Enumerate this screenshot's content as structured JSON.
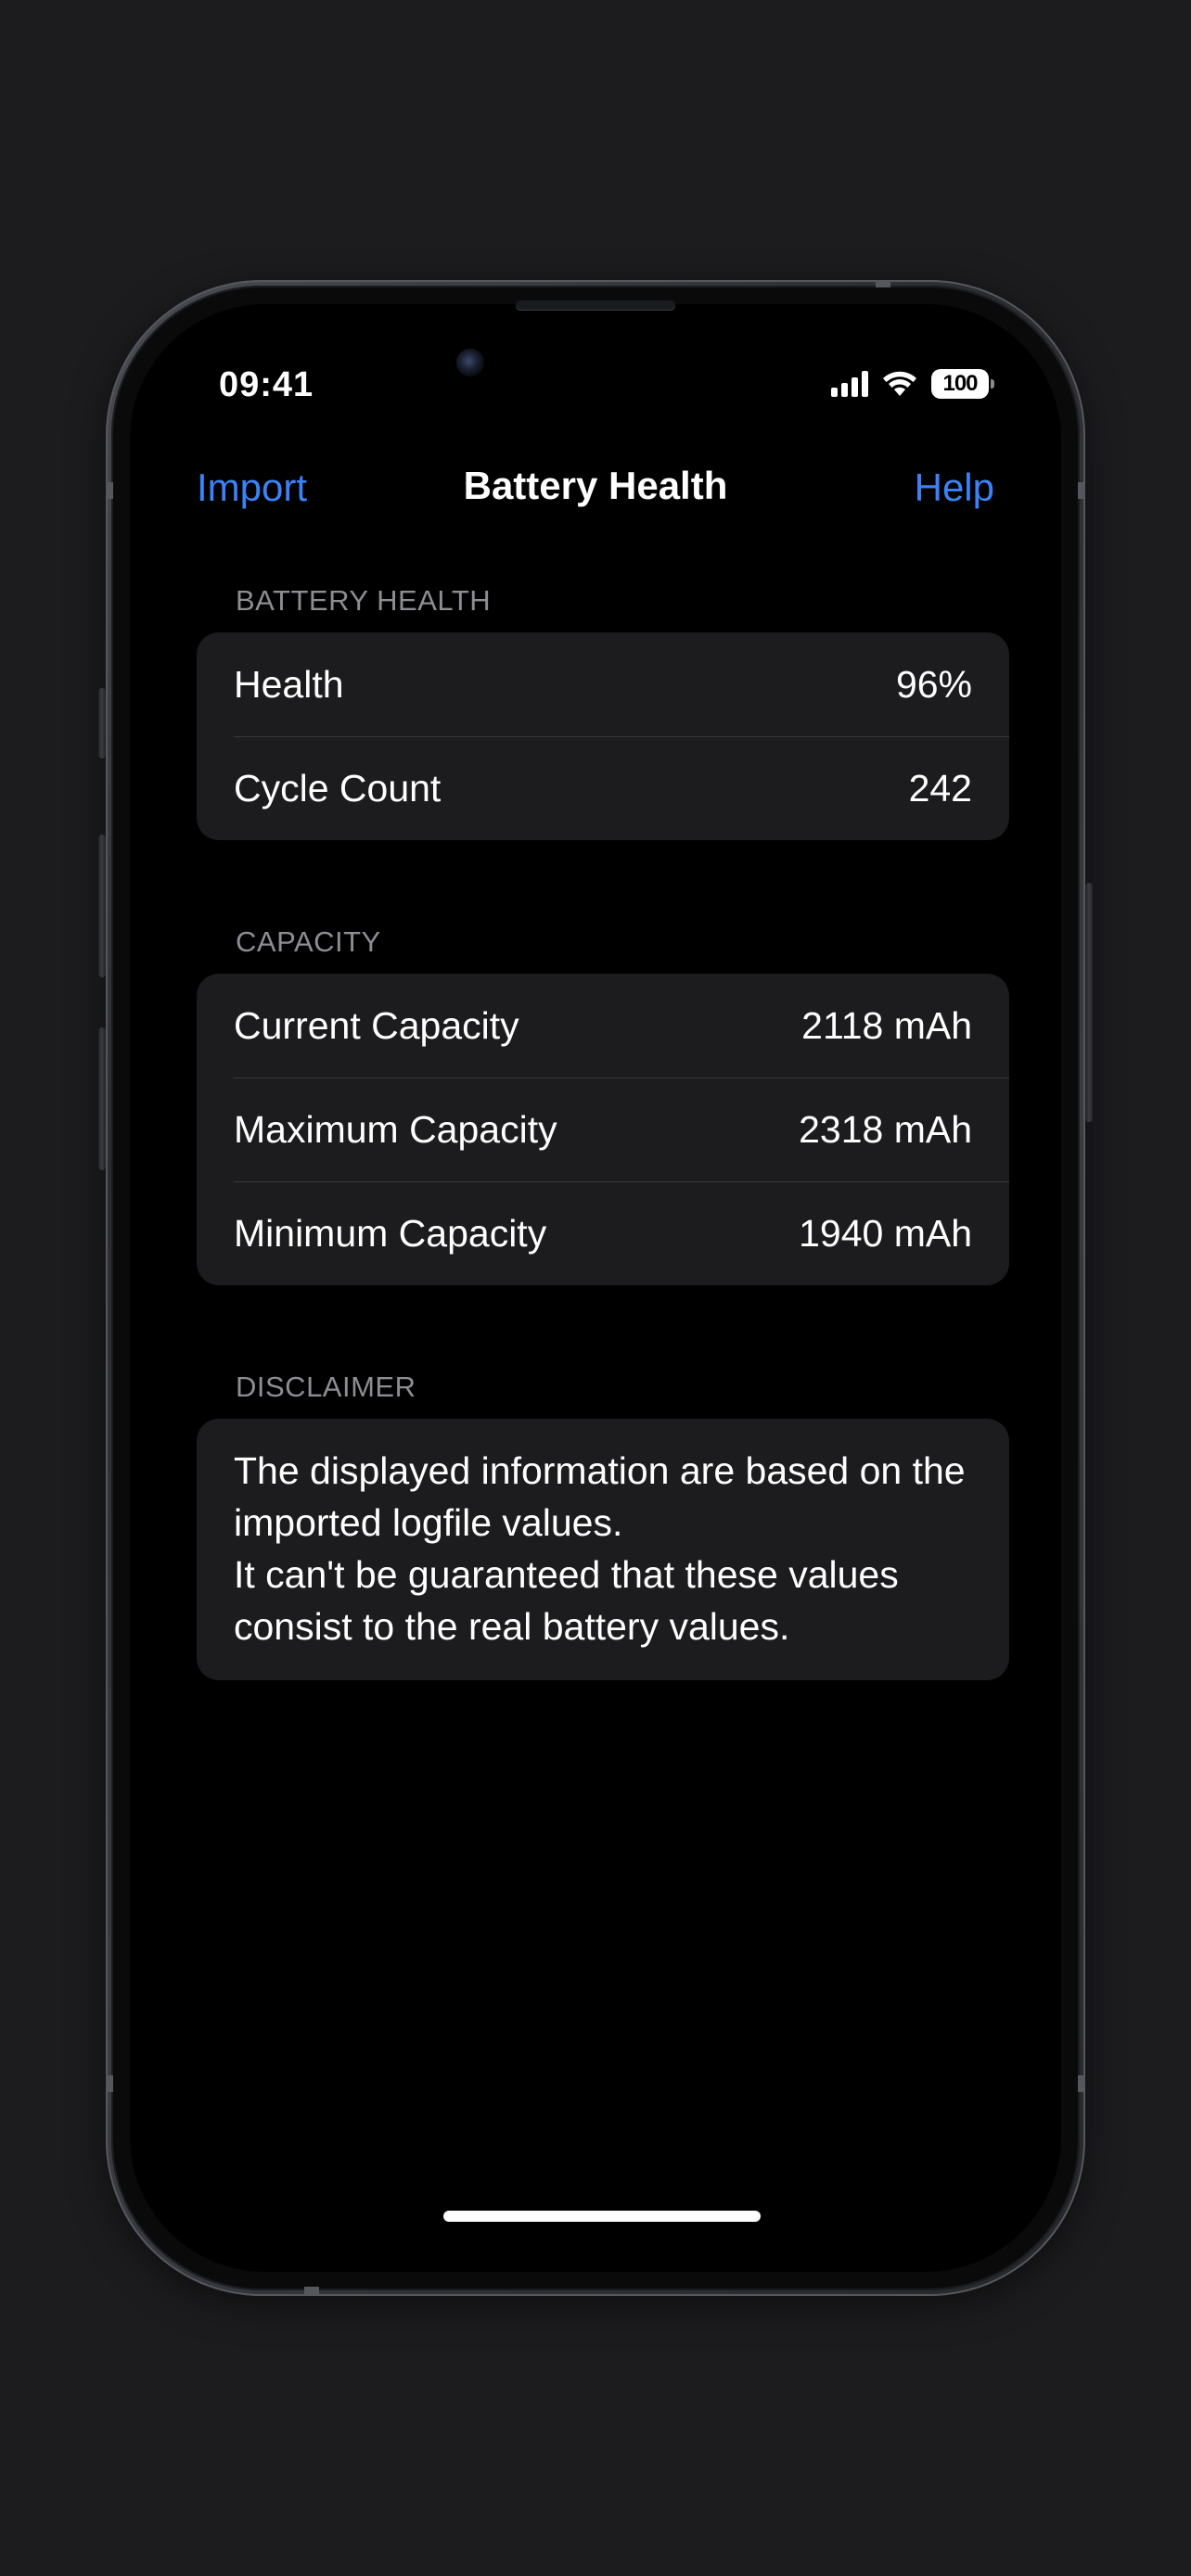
{
  "status_bar": {
    "time": "09:41",
    "battery_level": "100"
  },
  "nav": {
    "left_label": "Import",
    "title": "Battery Health",
    "right_label": "Help"
  },
  "sections": {
    "battery_health": {
      "header": "BATTERY HEALTH",
      "rows": [
        {
          "label": "Health",
          "value": "96%"
        },
        {
          "label": "Cycle Count",
          "value": "242"
        }
      ]
    },
    "capacity": {
      "header": "CAPACITY",
      "rows": [
        {
          "label": "Current Capacity",
          "value": "2118 mAh"
        },
        {
          "label": "Maximum Capacity",
          "value": "2318 mAh"
        },
        {
          "label": "Minimum Capacity",
          "value": "1940 mAh"
        }
      ]
    },
    "disclaimer": {
      "header": "DISCLAIMER",
      "line1": "The displayed information are based on the imported logfile values.",
      "line2": "It can't be guaranteed that these values consist to the real battery values."
    }
  },
  "colors": {
    "accent": "#3b82f6",
    "background": "#000000",
    "group_background": "#1c1c1e",
    "secondary_text": "#8d8d93"
  },
  "icons": {
    "signal": "cellular-signal-icon",
    "wifi": "wifi-icon",
    "battery": "battery-icon"
  }
}
